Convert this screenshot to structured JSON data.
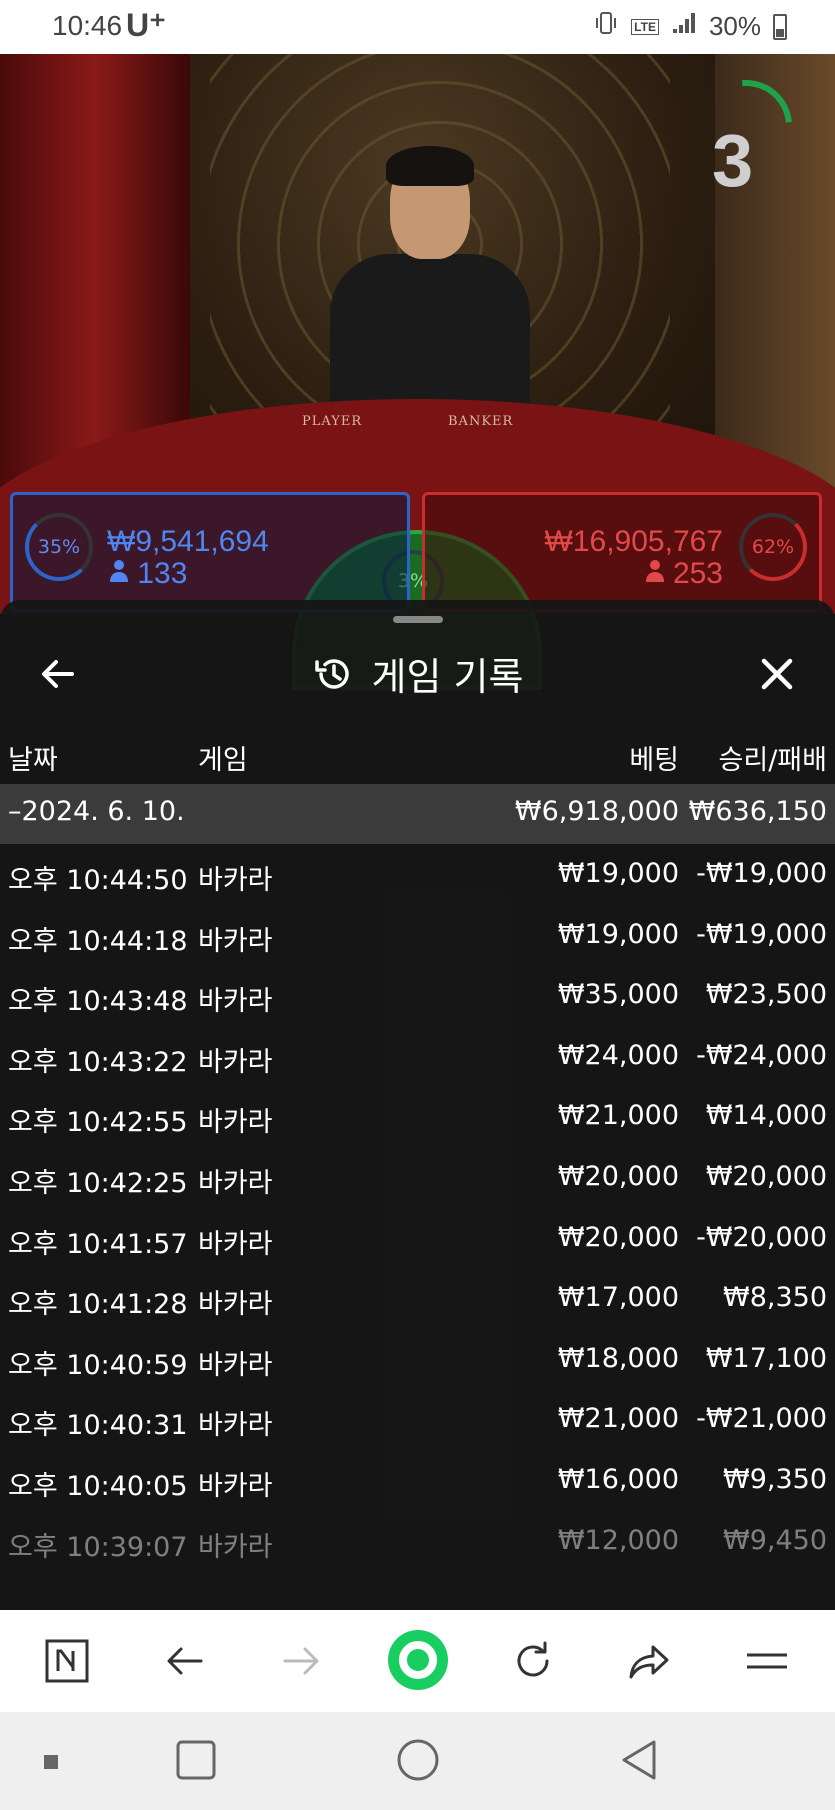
{
  "status_bar": {
    "time": "10:46",
    "carrier": "U⁺",
    "network": "LTE",
    "battery": "30%"
  },
  "game_view": {
    "countdown": "3",
    "table_labels": {
      "player": "PLAYER",
      "banker": "BANKER"
    },
    "player": {
      "percent": "35%",
      "amount": "₩9,541,694",
      "count": "133"
    },
    "tie": {
      "percent": "3%"
    },
    "banker": {
      "percent": "62%",
      "amount": "₩16,905,767",
      "count": "253"
    }
  },
  "sheet": {
    "title": "게임 기록",
    "columns": {
      "date": "날짜",
      "game": "게임",
      "bet": "베팅",
      "result": "승리/패배"
    },
    "date_group": {
      "label": "–2024. 6. 10.",
      "bet_total": "₩6,918,000",
      "result_total": "₩636,150"
    },
    "rows": [
      {
        "time": "오후 10:44:50",
        "game": "바카라",
        "bet": "₩19,000",
        "result": "-₩19,000"
      },
      {
        "time": "오후 10:44:18",
        "game": "바카라",
        "bet": "₩19,000",
        "result": "-₩19,000"
      },
      {
        "time": "오후 10:43:48",
        "game": "바카라",
        "bet": "₩35,000",
        "result": "₩23,500"
      },
      {
        "time": "오후 10:43:22",
        "game": "바카라",
        "bet": "₩24,000",
        "result": "-₩24,000"
      },
      {
        "time": "오후 10:42:55",
        "game": "바카라",
        "bet": "₩21,000",
        "result": "₩14,000"
      },
      {
        "time": "오후 10:42:25",
        "game": "바카라",
        "bet": "₩20,000",
        "result": "₩20,000"
      },
      {
        "time": "오후 10:41:57",
        "game": "바카라",
        "bet": "₩20,000",
        "result": "-₩20,000"
      },
      {
        "time": "오후 10:41:28",
        "game": "바카라",
        "bet": "₩17,000",
        "result": "₩8,350"
      },
      {
        "time": "오후 10:40:59",
        "game": "바카라",
        "bet": "₩18,000",
        "result": "₩17,100"
      },
      {
        "time": "오후 10:40:31",
        "game": "바카라",
        "bet": "₩21,000",
        "result": "-₩21,000"
      },
      {
        "time": "오후 10:40:05",
        "game": "바카라",
        "bet": "₩16,000",
        "result": "₩9,350"
      },
      {
        "time": "오후 10:39:07",
        "game": "바카라",
        "bet": "₩12,000",
        "result": "₩9,450"
      }
    ]
  },
  "browser_bar": {
    "icons": [
      "naver-n-icon",
      "back-arrow-icon",
      "forward-arrow-icon",
      "green-home-icon",
      "reload-icon",
      "share-icon",
      "menu-icon"
    ]
  },
  "colors": {
    "player": "#2d64c9",
    "banker": "#c92d2d",
    "tie": "#2fa53b",
    "browser_green": "#19ce60"
  }
}
